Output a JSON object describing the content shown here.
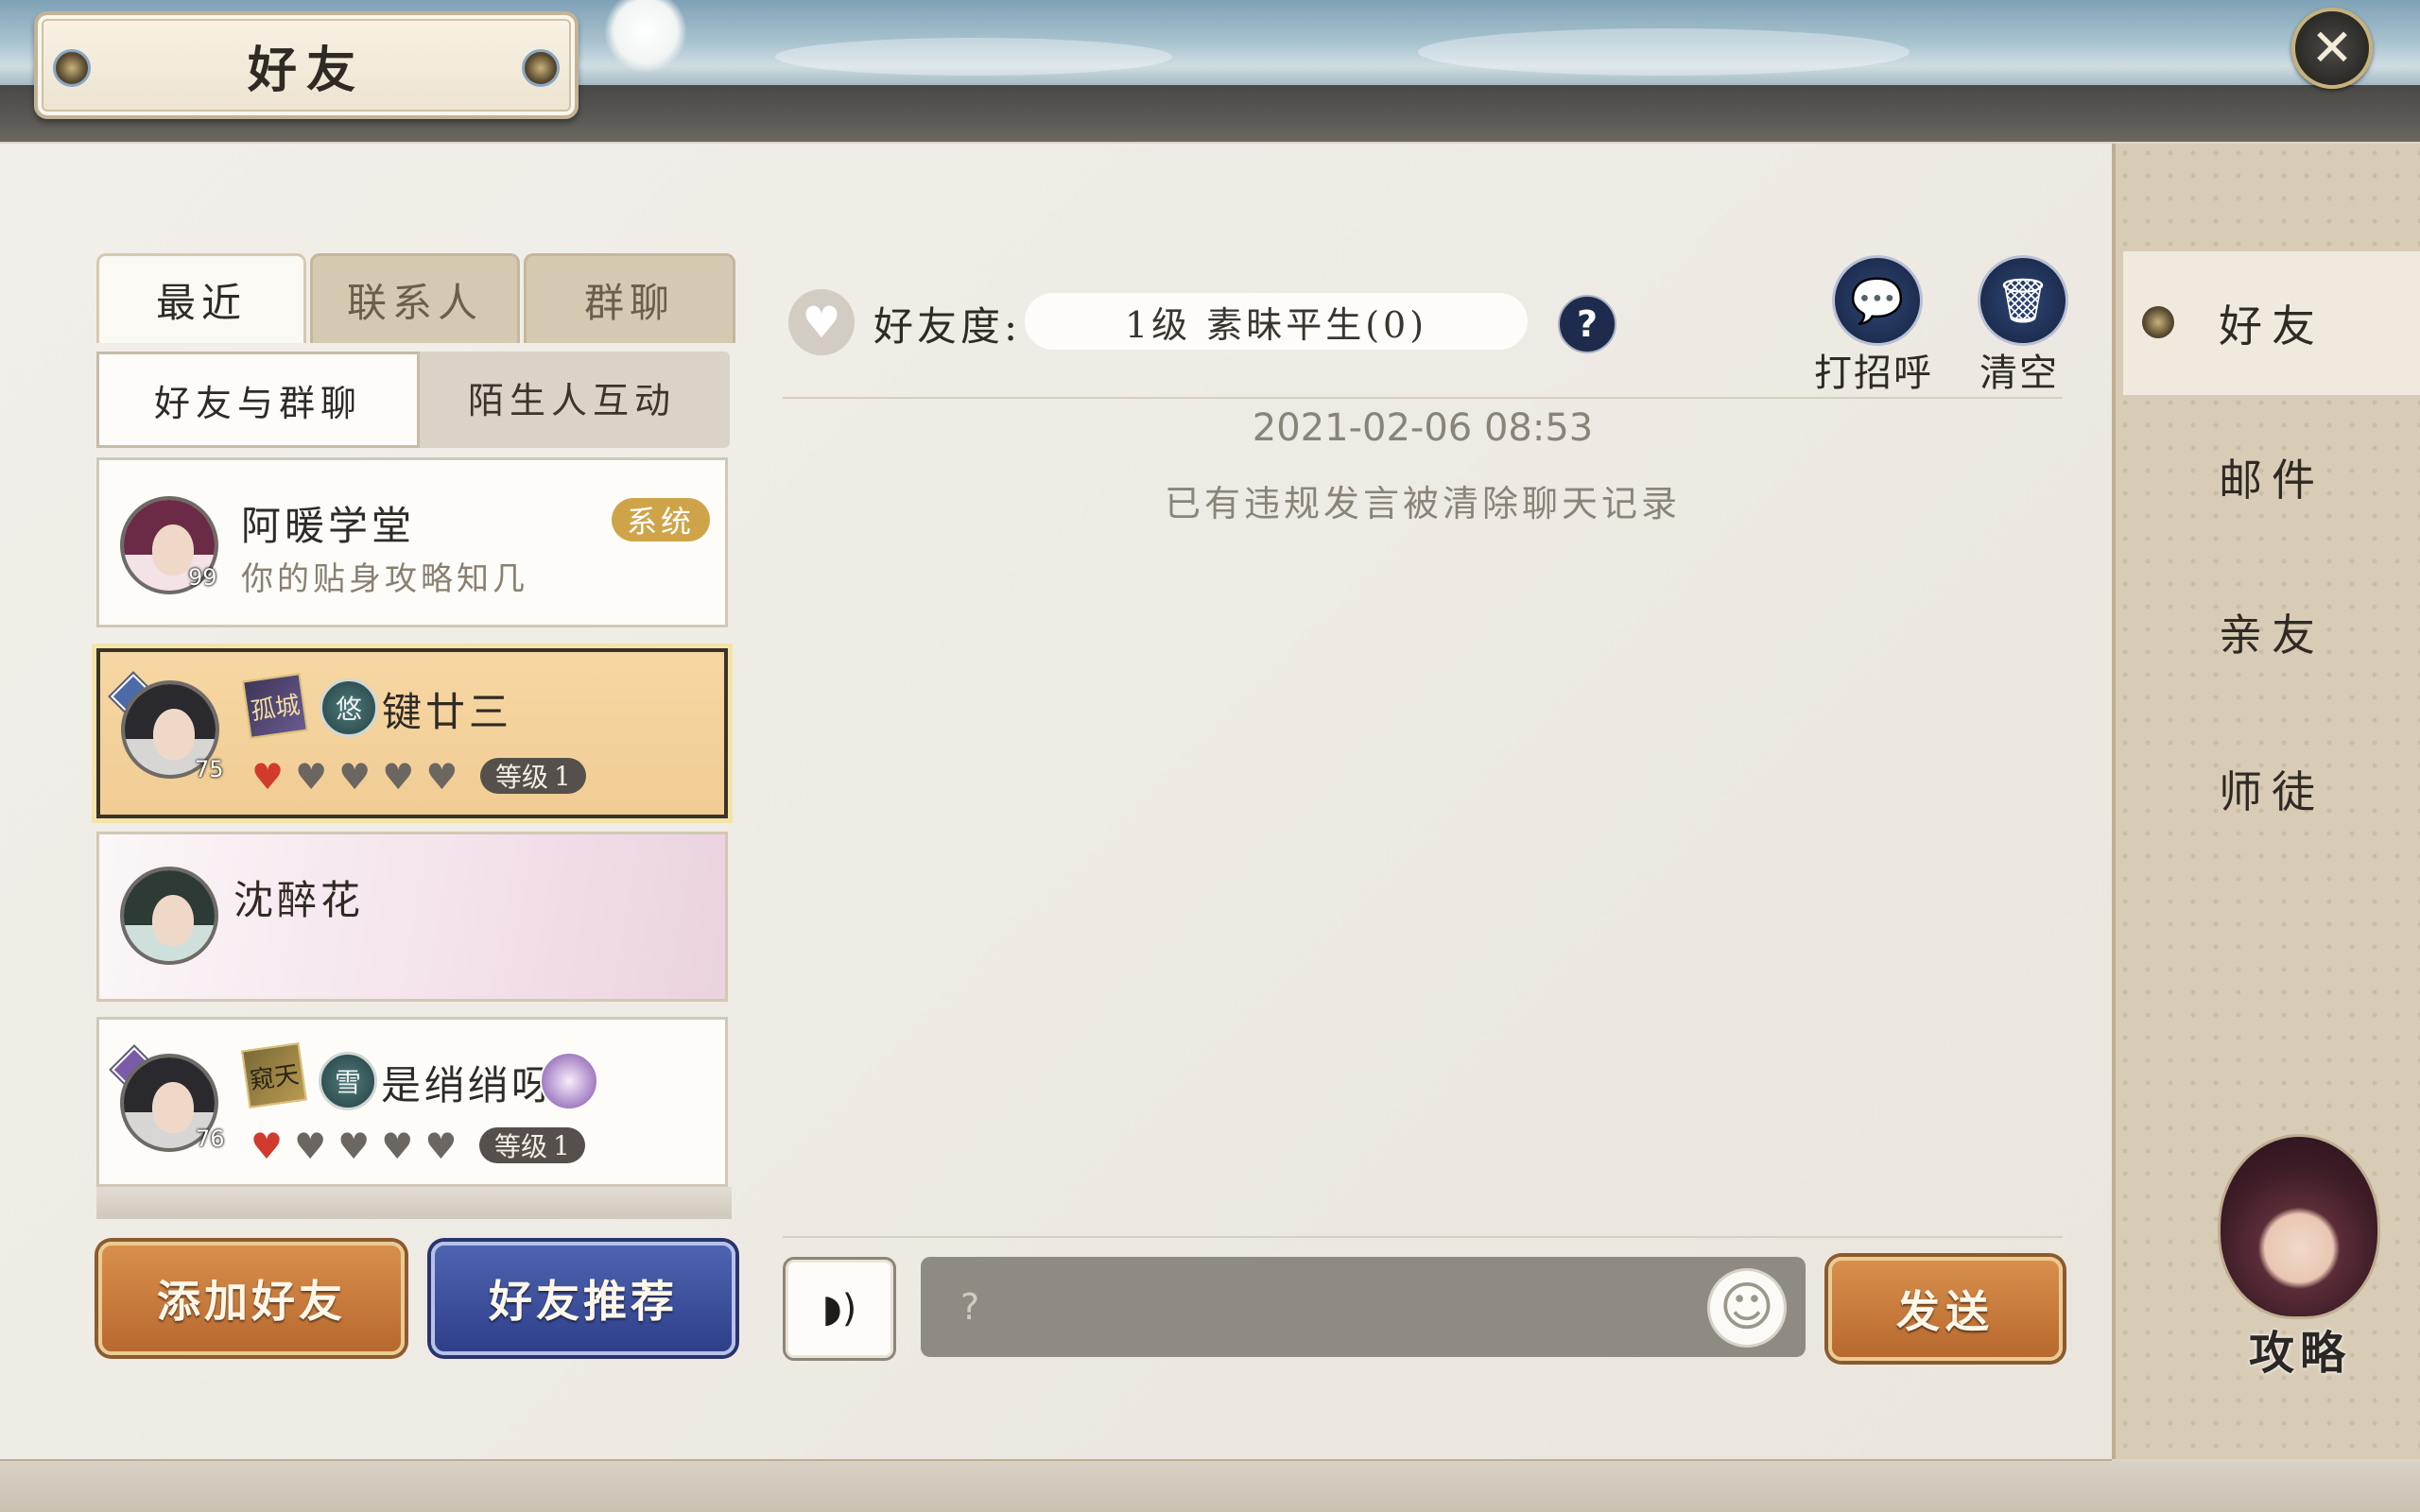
{
  "header": {
    "title": "好友",
    "close_icon": "close-icon"
  },
  "tabs": [
    {
      "label": "最近",
      "active": true
    },
    {
      "label": "联系人",
      "active": false
    },
    {
      "label": "群聊",
      "active": false
    }
  ],
  "subtabs": [
    {
      "label": "好友与群聊",
      "active": true
    },
    {
      "label": "陌生人互动",
      "active": false
    }
  ],
  "conversations": [
    {
      "name": "阿暖学堂",
      "subtitle": "你的贴身攻略知几",
      "badge": "系统",
      "avatar_level": "99"
    },
    {
      "name": "键廿三",
      "avatar_level": "75",
      "guild_tag": "孤城",
      "school_tag": "悠",
      "hearts_filled": 1,
      "hearts_total": 5,
      "level_label": "等级",
      "level_value": "1",
      "selected": true
    },
    {
      "name": "沈醉花"
    },
    {
      "name": "是绡绡呀",
      "avatar_level": "76",
      "guild_tag": "窥天",
      "school_tag": "雪",
      "hearts_filled": 1,
      "hearts_total": 5,
      "level_label": "等级",
      "level_value": "1"
    }
  ],
  "buttons": {
    "add_friend": "添加好友",
    "recommend": "好友推荐",
    "send": "发送"
  },
  "chat": {
    "affinity_label": "好友度:",
    "affinity_value": "1级 素昧平生(0)",
    "help": "?",
    "greet_label": "打招呼",
    "clear_label": "清空",
    "timestamp": "2021-02-06 08:53",
    "notice": "已有违规发言被清除聊天记录",
    "input_placeholder": "?"
  },
  "rail": {
    "items": [
      {
        "label": "好友",
        "active": true
      },
      {
        "label": "邮件",
        "active": false
      },
      {
        "label": "亲友",
        "active": false
      },
      {
        "label": "师徒",
        "active": false
      }
    ],
    "guide_label": "攻略"
  },
  "colors": {
    "accent_orange": "#c57a3a",
    "accent_blue": "#3a4f9c",
    "selected_row": "#f3d39c",
    "heart_red": "#d23a2e"
  }
}
